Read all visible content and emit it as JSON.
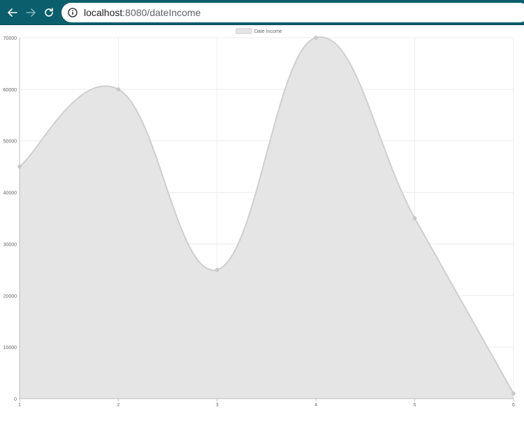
{
  "browser": {
    "url_host": "localhost",
    "url_port_path": ":8080/dateIncome"
  },
  "chart_data": {
    "type": "area",
    "x": [
      1,
      2,
      3,
      4,
      5,
      6
    ],
    "series": [
      {
        "name": "Date Income",
        "values": [
          45000,
          60000,
          25000,
          70000,
          35000,
          1000
        ]
      }
    ],
    "x_ticks": [
      "1",
      "2",
      "3",
      "4",
      "5",
      "6"
    ],
    "y_ticks": [
      "0",
      "10000",
      "20000",
      "30000",
      "40000",
      "50000",
      "60000",
      "70000"
    ],
    "ylim": [
      0,
      70000
    ],
    "grid": true,
    "legend_position": "top",
    "colors": {
      "fill": "#e5e5e5",
      "line": "#cfcfcf",
      "grid": "#ececec",
      "axis_text": "#666666"
    }
  }
}
